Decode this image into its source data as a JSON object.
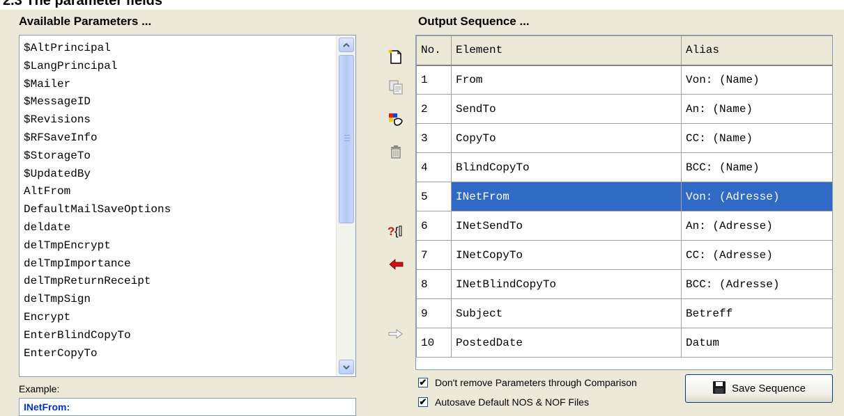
{
  "heading": "2.3 The parameter fields",
  "available": {
    "title": "Available Parameters ...",
    "items": [
      "$AltPrincipal",
      "$LangPrincipal",
      "$Mailer",
      "$MessageID",
      "$Revisions",
      "$RFSaveInfo",
      "$StorageTo",
      "$UpdatedBy",
      "AltFrom",
      "DefaultMailSaveOptions",
      "deldate",
      "delTmpEncrypt",
      "delTmpImportance",
      "delTmpReturnReceipt",
      "delTmpSign",
      "Encrypt",
      "EnterBlindCopyTo",
      "EnterCopyTo"
    ]
  },
  "example": {
    "label": "Example:",
    "value": "INetFrom:"
  },
  "output": {
    "title": "Output Sequence ...",
    "columns": [
      "No.",
      "Element",
      "Alias"
    ],
    "rows": [
      {
        "no": "1",
        "element": "From",
        "alias": "Von: (Name)"
      },
      {
        "no": "2",
        "element": "SendTo",
        "alias": "An: (Name)"
      },
      {
        "no": "3",
        "element": "CopyTo",
        "alias": "CC: (Name)"
      },
      {
        "no": "4",
        "element": "BlindCopyTo",
        "alias": "BCC: (Name)"
      },
      {
        "no": "5",
        "element": "INetFrom",
        "alias": "Von: (Adresse)"
      },
      {
        "no": "6",
        "element": "INetSendTo",
        "alias": "An: (Adresse)"
      },
      {
        "no": "7",
        "element": "INetCopyTo",
        "alias": "CC: (Adresse)"
      },
      {
        "no": "8",
        "element": "INetBlindCopyTo",
        "alias": "BCC: (Adresse)"
      },
      {
        "no": "9",
        "element": "Subject",
        "alias": "Betreff"
      },
      {
        "no": "10",
        "element": "PostedDate",
        "alias": "Datum"
      }
    ],
    "selected_row": "5"
  },
  "options": {
    "dont_remove_label": "Don't remove Parameters through Comparison",
    "dont_remove_checked": true,
    "autosave_label": "Autosave Default NOS & NOF Files",
    "autosave_checked": true
  },
  "save_button_label": "Save Sequence",
  "icons": {
    "new": "new-document-icon",
    "copy": "copy-icon",
    "color": "color-palette-icon",
    "delete": "trash-icon",
    "formula": "formula-icon",
    "add": "red-arrow-left-icon",
    "remove": "arrow-right-icon",
    "save": "floppy-disk-icon"
  },
  "colors": {
    "selection": "#316ac5",
    "window": "#ece9d8",
    "example_text": "#0033cc"
  }
}
